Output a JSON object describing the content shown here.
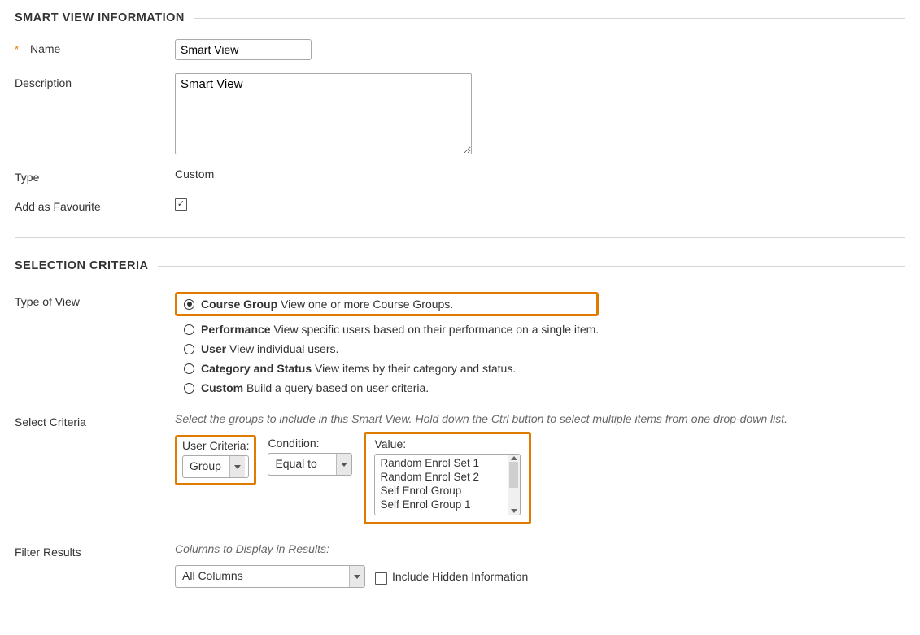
{
  "section1_title": "SMART VIEW INFORMATION",
  "name_label": "Name",
  "name_value": "Smart View",
  "description_label": "Description",
  "description_value": "Smart View",
  "type_label": "Type",
  "type_value": "Custom",
  "favourite_label": "Add as Favourite",
  "favourite_checked": "✓",
  "section2_title": "SELECTION CRITERIA",
  "type_of_view_label": "Type of View",
  "radios": {
    "r0_bold": "Course Group",
    "r0_desc": "View one or more Course Groups.",
    "r1_bold": "Performance",
    "r1_desc": "View specific users based on their performance on a single item.",
    "r2_bold": "User",
    "r2_desc": "View individual users.",
    "r3_bold": "Category and Status",
    "r3_desc": "View items by their category and status.",
    "r4_bold": "Custom",
    "r4_desc": "Build a query based on user criteria."
  },
  "select_criteria_label": "Select Criteria",
  "select_criteria_hint": "Select the groups to include in this Smart View. Hold down the Ctrl button to select multiple items from one drop-down list.",
  "user_criteria_label": "User Criteria:",
  "user_criteria_value": "Group",
  "condition_label": "Condition:",
  "condition_value": "Equal to",
  "value_label": "Value:",
  "value_options": {
    "v0": "Random Enrol Set 1",
    "v1": "Random Enrol Set 2",
    "v2": "Self Enrol Group",
    "v3": "Self Enrol Group 1"
  },
  "filter_results_label": "Filter Results",
  "columns_hint": "Columns to Display in Results:",
  "columns_value": "All Columns",
  "include_hidden_label": "Include Hidden Information"
}
